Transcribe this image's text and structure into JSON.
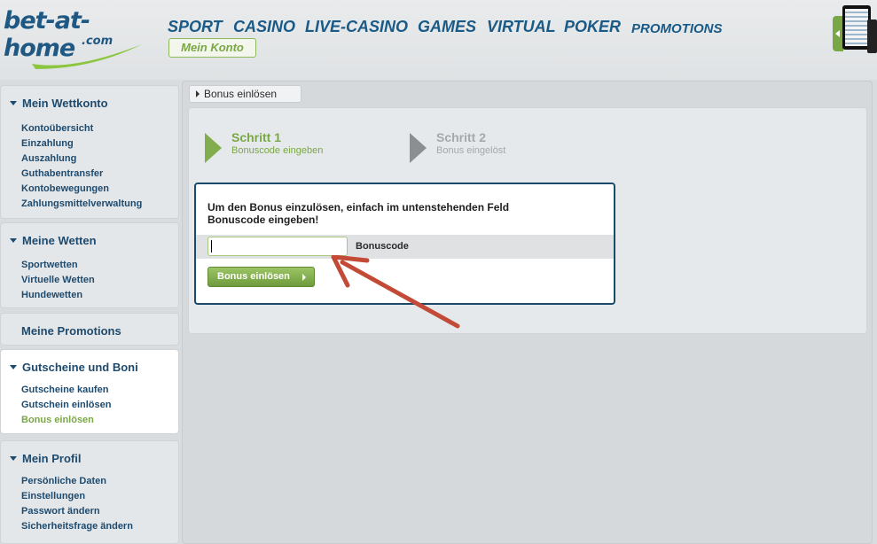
{
  "brand": {
    "logo_text": "bet-at-home",
    "logo_sub": ".com",
    "primary_color": "#1e5883",
    "accent_color": "#7aa745"
  },
  "nav": {
    "items": [
      "SPORT",
      "CASINO",
      "LIVE-CASINO",
      "GAMES",
      "VIRTUAL",
      "POKER",
      "PROMOTIONS"
    ],
    "account_button": "Mein Konto"
  },
  "sidebar": {
    "sections": [
      {
        "title": "Mein Wettkonto",
        "links": [
          "Kontoübersicht",
          "Einzahlung",
          "Auszahlung",
          "Guthabentransfer",
          "Kontobewegungen",
          "Zahlungsmittelverwaltung"
        ]
      },
      {
        "title": "Meine Wetten",
        "links": [
          "Sportwetten",
          "Virtuelle Wetten",
          "Hundewetten"
        ]
      },
      {
        "title": "Meine Promotions",
        "links": []
      },
      {
        "title": "Gutscheine und Boni",
        "links": [
          "Gutscheine kaufen",
          "Gutschein einlösen",
          "Bonus einlösen"
        ]
      },
      {
        "title": "Mein Profil",
        "links": [
          "Persönliche Daten",
          "Einstellungen",
          "Passwort ändern",
          "Sicherheitsfrage ändern"
        ]
      }
    ]
  },
  "main": {
    "breadcrumb": "Bonus einlösen",
    "steps": [
      {
        "title": "Schritt 1",
        "subtitle": "Bonuscode eingeben",
        "state": "active"
      },
      {
        "title": "Schritt 2",
        "subtitle": "Bonus eingelöst",
        "state": "inactive"
      }
    ],
    "instruction_line1": "Um den Bonus einzulösen, einfach im untenstehenden Feld",
    "instruction_line2": "Bonuscode eingeben!",
    "input_value": "",
    "input_label": "Bonuscode",
    "submit_label": "Bonus einlösen"
  },
  "annotation": {
    "arrow_color": "#c24a36"
  }
}
